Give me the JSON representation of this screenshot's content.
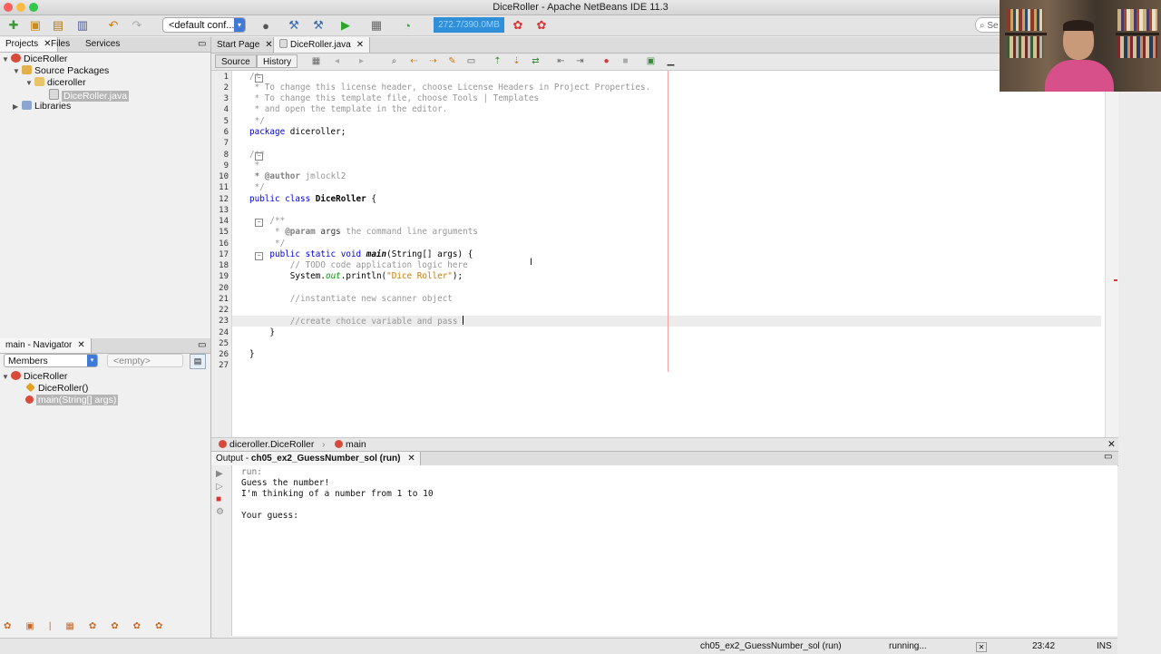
{
  "window": {
    "title": "DiceRoller - Apache NetBeans IDE 11.3"
  },
  "toolbar": {
    "config_label": "<default conf...",
    "memory_label": "272.7/390.0MB",
    "search_placeholder": "Se"
  },
  "projects_panel": {
    "tabs": [
      "Projects",
      "Files",
      "Services"
    ],
    "tree": {
      "project": "DiceRoller",
      "source_packages": "Source Packages",
      "package": "diceroller",
      "file": "DiceRoller.java",
      "libraries": "Libraries"
    }
  },
  "navigator": {
    "tab_label": "main - Navigator",
    "members_label": "Members",
    "filter_label": "<empty>",
    "items": [
      "DiceRoller",
      "DiceRoller()",
      "main(String[] args)"
    ]
  },
  "editor": {
    "tabs": [
      "Start Page",
      "DiceRoller.java"
    ],
    "source_label": "Source",
    "history_label": "History",
    "line_numbers": [
      "1",
      "2",
      "3",
      "4",
      "5",
      "6",
      "7",
      "8",
      "9",
      "10",
      "11",
      "12",
      "13",
      "14",
      "15",
      "16",
      "17",
      "18",
      "19",
      "20",
      "21",
      "22",
      "23",
      "24",
      "25",
      "26",
      "27"
    ],
    "code": {
      "l1": "/*",
      "l2": " * To change this license header, choose License Headers in Project Properties.",
      "l3": " * To change this template file, choose Tools | Templates",
      "l4": " * and open the template in the editor.",
      "l5": " */",
      "l6_kw": "package",
      "l6_rest": " diceroller;",
      "l8": "/**",
      "l9": " *",
      "l10_tag": " * @author",
      "l10_rest": " jmlockl2",
      "l11": " */",
      "l12_kw": "public class",
      "l12_name": " DiceRoller",
      "l12_rest": " {",
      "l14": "    /**",
      "l15_a": "     * ",
      "l15_tag": "@param",
      "l15_arg": " args",
      "l15_rest": " the command line arguments",
      "l16": "     */",
      "l17_kw": "    public static void",
      "l17_name": " main",
      "l17_rest": "(String[] args) {",
      "l18": "        // TODO code application logic here",
      "l19_a": "        System.",
      "l19_field": "out",
      "l19_b": ".println(",
      "l19_str": "\"Dice Roller\"",
      "l19_c": ");",
      "l21": "        //instantiate new scanner object",
      "l23": "        //create choice variable and pass ",
      "l24": "    }",
      "l26": "}"
    },
    "breadcrumb": {
      "class_label": "diceroller.DiceRoller",
      "method_label": "main"
    }
  },
  "output": {
    "tab_label": "Output - ",
    "tab_name": "ch05_ex2_GuessNumber_sol (run)",
    "lines": [
      "run:",
      "Guess the number!",
      "I'm thinking of a number from 1 to 10",
      "",
      "Your guess:"
    ]
  },
  "status": {
    "task": "ch05_ex2_GuessNumber_sol (run)",
    "progress_label": "running...",
    "position": "23:42",
    "mode": "INS"
  },
  "colors": {
    "accent": "#2f8fd8",
    "keyword": "#0000e6",
    "string": "#ce7b00",
    "comment": "#969696"
  }
}
